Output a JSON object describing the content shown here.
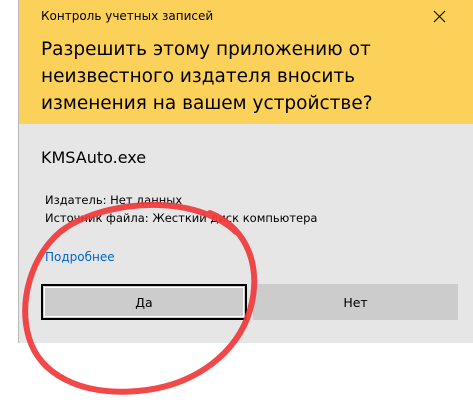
{
  "window": {
    "title": "Контроль учетных записей",
    "close_glyph": "close-icon"
  },
  "header": {
    "question": "Разрешить этому приложению от неизвестного издателя вносить изменения на вашем устройстве?",
    "background_color": "#fcd15a"
  },
  "app": {
    "name": "KMSAuto.exe"
  },
  "details": {
    "publisher": "Издатель: Нет данных",
    "source": "Источник файла: Жесткий диск компьютера"
  },
  "links": {
    "more": "Подробнее"
  },
  "buttons": {
    "yes": "Да",
    "no": "Нет"
  },
  "annotation": {
    "shape": "hand-drawn circle",
    "color": "#f03a3a"
  }
}
